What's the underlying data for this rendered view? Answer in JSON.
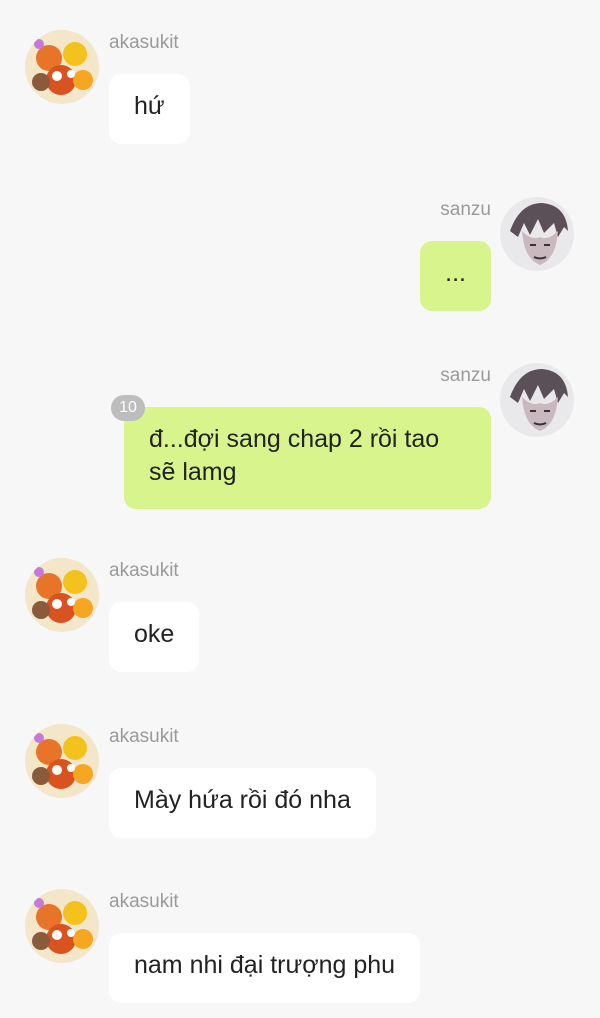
{
  "messages": [
    {
      "side": "left",
      "sender": "akasukit",
      "avatar": "akasukit-avatar-icon",
      "text": "hứ"
    },
    {
      "side": "right",
      "sender": "sanzu",
      "avatar": "sanzu-avatar-icon",
      "text": "..."
    },
    {
      "side": "right",
      "sender": "sanzu",
      "avatar": "sanzu-avatar-icon",
      "text": "đ...đợi sang chap 2 rồi tao sẽ lamg",
      "badge": "10"
    },
    {
      "side": "left",
      "sender": "akasukit",
      "avatar": "akasukit-avatar-icon",
      "text": "oke"
    },
    {
      "side": "left",
      "sender": "akasukit",
      "avatar": "akasukit-avatar-icon",
      "text": "Mày hứa rồi đó nha"
    },
    {
      "side": "left",
      "sender": "akasukit",
      "avatar": "akasukit-avatar-icon",
      "text": "nam nhi đại trượng phu"
    }
  ],
  "colors": {
    "background": "#f7f7f7",
    "incoming_bubble": "#ffffff",
    "outgoing_bubble": "#d7f58c",
    "name_text": "#9a9a9a",
    "badge": "#bdbdbd"
  }
}
